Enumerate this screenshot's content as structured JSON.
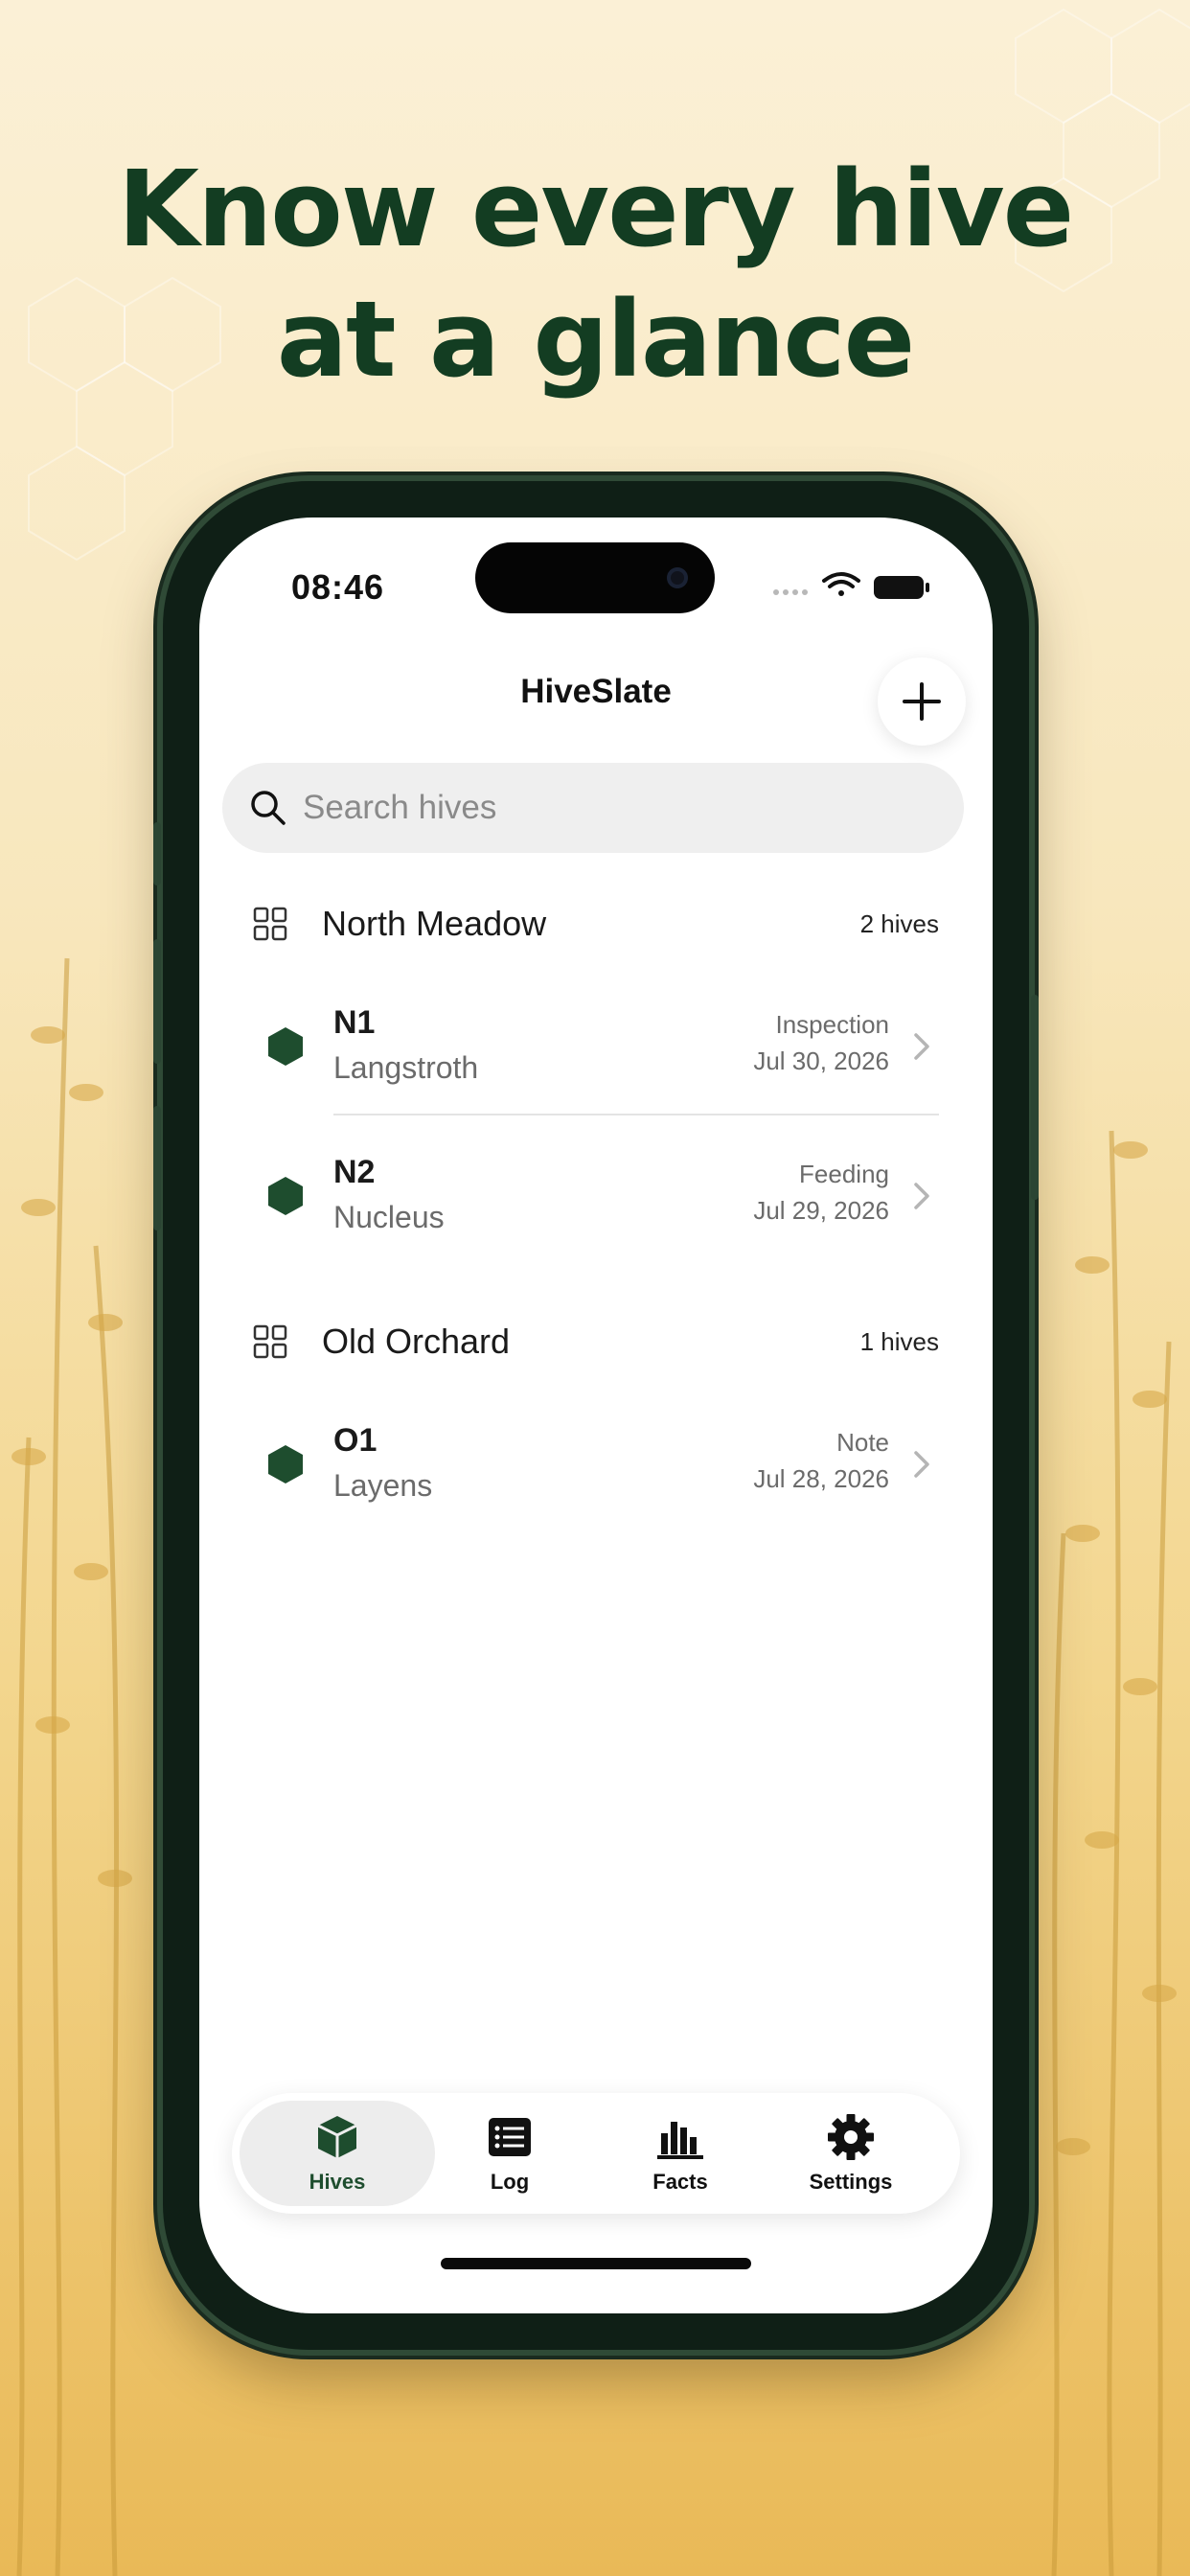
{
  "headline": {
    "line1": "Know every hive",
    "line2": "at a glance"
  },
  "status_bar": {
    "time": "08:46"
  },
  "nav": {
    "title": "HiveSlate",
    "add_icon": "plus-icon"
  },
  "search": {
    "placeholder": "Search hives",
    "value": ""
  },
  "groups": [
    {
      "title": "North Meadow",
      "count": "2 hives",
      "hives": [
        {
          "name": "N1",
          "type": "Langstroth",
          "event": "Inspection",
          "date": "Jul 30, 2026"
        },
        {
          "name": "N2",
          "type": "Nucleus",
          "event": "Feeding",
          "date": "Jul 29, 2026"
        }
      ]
    },
    {
      "title": "Old Orchard",
      "count": "1 hives",
      "hives": [
        {
          "name": "O1",
          "type": "Layens",
          "event": "Note",
          "date": "Jul 28, 2026"
        }
      ]
    }
  ],
  "tabbar": {
    "active": "Hives",
    "tabs": [
      {
        "label": "Hives",
        "icon": "hive-box-icon"
      },
      {
        "label": "Log",
        "icon": "log-list-icon"
      },
      {
        "label": "Facts",
        "icon": "bar-chart-icon"
      },
      {
        "label": "Settings",
        "icon": "gear-icon"
      }
    ]
  },
  "colors": {
    "accent": "#1e4d2e",
    "headline": "#133d22",
    "background_top": "#fbf0d6",
    "background_bottom": "#e9b957"
  }
}
